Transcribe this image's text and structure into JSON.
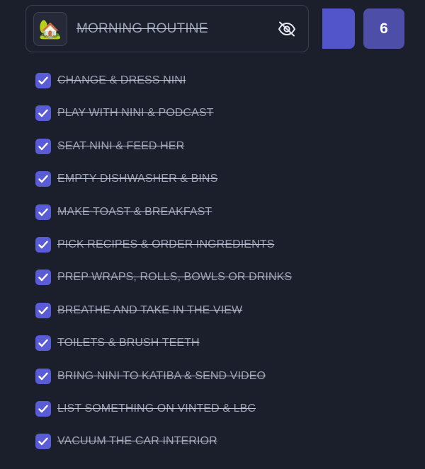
{
  "header": {
    "emoji": "🏡",
    "title": "MORNING ROUTINE",
    "count": "6"
  },
  "colors": {
    "background": "#1b1e2b",
    "accent": "#5a5cd6",
    "color_button": "#5254c9",
    "count_button": "#4d4ea8",
    "text_muted": "#9aa1b4"
  },
  "icons": {
    "visibility": "eye-off-icon",
    "check": "checkmark-icon"
  },
  "tasks": [
    {
      "label": "CHANGE & DRESS NINI",
      "checked": true
    },
    {
      "label": "PLAY WITH NINI & PODCAST",
      "checked": true
    },
    {
      "label": "SEAT NINI & FEED HER",
      "checked": true
    },
    {
      "label": "EMPTY DISHWASHER & BINS",
      "checked": true
    },
    {
      "label": "MAKE TOAST & BREAKFAST",
      "checked": true
    },
    {
      "label": "PICK RECIPES & ORDER INGREDIENTS",
      "checked": true
    },
    {
      "label": "PREP WRAPS, ROLLS, BOWLS OR DRINKS",
      "checked": true
    },
    {
      "label": "BREATHE AND TAKE IN THE VIEW",
      "checked": true
    },
    {
      "label": "TOILETS & BRUSH TEETH",
      "checked": true
    },
    {
      "label": "BRING NINI TO KATIBA & SEND VIDEO",
      "checked": true
    },
    {
      "label": "LIST SOMETHING ON VINTED & LBC",
      "checked": true
    },
    {
      "label": "VACUUM THE CAR INTERIOR",
      "checked": true
    }
  ]
}
